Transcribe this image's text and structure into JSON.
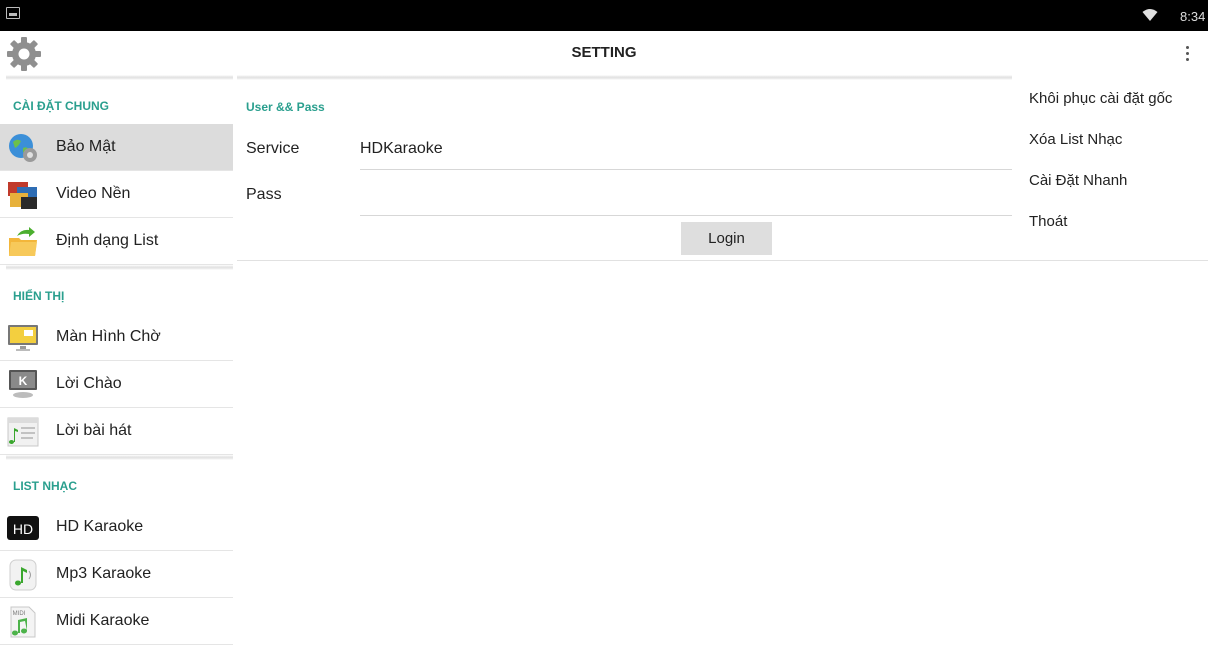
{
  "status_bar": {
    "time": "8:34"
  },
  "action_bar": {
    "title": "SETTING"
  },
  "sidebar": {
    "sections": [
      {
        "header": "CÀI ĐẶT CHUNG",
        "items": [
          {
            "label": "Bảo Mật",
            "icon": "globe-gear-icon",
            "active": true
          },
          {
            "label": "Video Nền",
            "icon": "video-collage-icon"
          },
          {
            "label": "Định dạng List",
            "icon": "folder-arrow-icon"
          }
        ]
      },
      {
        "header": "HIỂN THỊ",
        "items": [
          {
            "label": "Màn Hình Chờ",
            "icon": "monitor-icon"
          },
          {
            "label": "Lời Chào",
            "icon": "kde-monitor-icon"
          },
          {
            "label": "Lời bài hát",
            "icon": "lyrics-note-icon"
          }
        ]
      },
      {
        "header": "LIST NHẠC",
        "items": [
          {
            "label": "HD Karaoke",
            "icon": "hd-icon"
          },
          {
            "label": "Mp3 Karaoke",
            "icon": "music-note-icon"
          },
          {
            "label": "Midi Karaoke",
            "icon": "midi-file-icon"
          }
        ]
      }
    ]
  },
  "main": {
    "section_title": "User && Pass",
    "fields": [
      {
        "label": "Service",
        "value": "HDKaraoke"
      },
      {
        "label": "Pass",
        "value": ""
      }
    ],
    "login_label": "Login"
  },
  "menu": {
    "items": [
      "Khôi phục cài đặt gốc",
      "Xóa List Nhạc",
      "Cài Đặt Nhanh",
      "Thoát"
    ]
  },
  "colors": {
    "accent": "#2a9f8e",
    "active_row": "#dcdcdc"
  }
}
